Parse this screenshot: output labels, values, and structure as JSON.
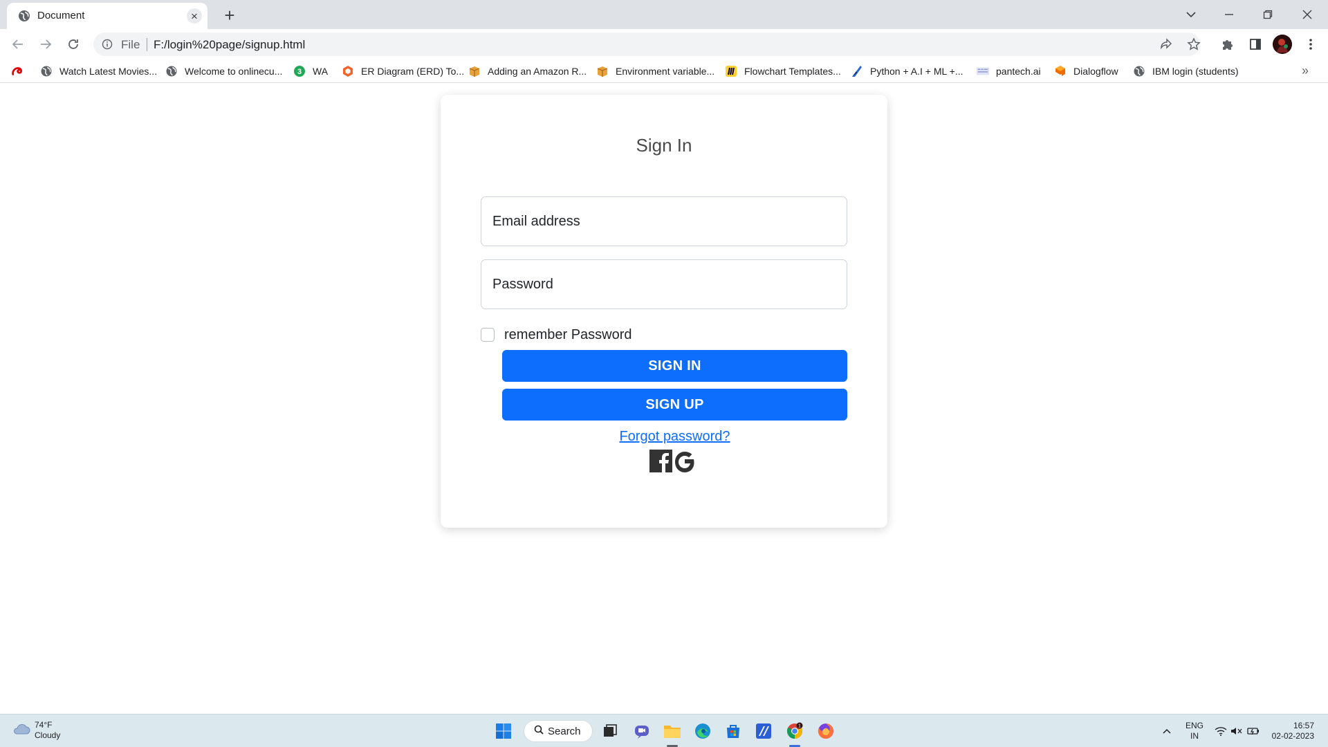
{
  "browser": {
    "tab_title": "Document",
    "url_scheme": "File",
    "url": "F:/login%20page/signup.html"
  },
  "bookmarks": [
    {
      "label": "",
      "icon": "airtel-icon",
      "color": "#e40000"
    },
    {
      "label": "Watch Latest Movies...",
      "icon": "globe-icon"
    },
    {
      "label": "Welcome to onlinecu...",
      "icon": "globe-icon"
    },
    {
      "label": "WA",
      "icon": "whatsapp-badge-icon",
      "badge": "3",
      "color": "#1fa855"
    },
    {
      "label": "ER Diagram (ERD) To...",
      "icon": "lucidchart-icon",
      "color": "#f0662f"
    },
    {
      "label": "Adding an Amazon R...",
      "icon": "aws-box-icon",
      "color": "#e8a23b"
    },
    {
      "label": "Environment variable...",
      "icon": "aws-box-icon",
      "color": "#e8a23b"
    },
    {
      "label": "Flowchart Templates...",
      "icon": "miro-icon",
      "color": "#ffd02f"
    },
    {
      "label": "Python + A.I + ML +...",
      "icon": "python-blade-icon",
      "color": "#2b66d9"
    },
    {
      "label": "pantech.ai",
      "icon": "pantech-icon",
      "color": "#8f9bd6"
    },
    {
      "label": "Dialogflow",
      "icon": "dialogflow-icon",
      "color": "#ef6c00"
    },
    {
      "label": "IBM login (students)",
      "icon": "globe-icon"
    }
  ],
  "page": {
    "title": "Sign In",
    "email_placeholder": "Email address",
    "password_placeholder": "Password",
    "remember_label": "remember Password",
    "signin_label": "SIGN IN",
    "signup_label": "SIGN UP",
    "forgot_label": "Forgot password?",
    "accent_color": "#0d6efd",
    "social_icons": [
      "facebook-icon",
      "google-icon"
    ]
  },
  "taskbar": {
    "weather_temp": "74°F",
    "weather_cond": "Cloudy",
    "search_label": "Search",
    "lang_line1": "ENG",
    "lang_line2": "IN",
    "time": "16:57",
    "date": "02-02-2023",
    "chrome_badge": "1"
  }
}
